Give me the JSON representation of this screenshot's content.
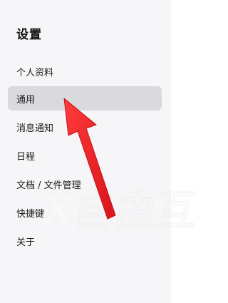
{
  "settings": {
    "title": "设置",
    "nav_items": [
      {
        "label": "个人资料"
      },
      {
        "label": "通用",
        "active": true
      },
      {
        "label": "消息通知"
      },
      {
        "label": "日程"
      },
      {
        "label": "文档 / 文件管理"
      },
      {
        "label": "快捷键"
      },
      {
        "label": "关于"
      }
    ]
  },
  "colors": {
    "sidebar_bg": "#f6f6f8",
    "active_item_bg": "#d9d9de",
    "arrow": "#e8232a"
  },
  "overlay": {
    "arrow_icon": "red-arrow-annotation",
    "watermark_text": "X自由互联"
  }
}
